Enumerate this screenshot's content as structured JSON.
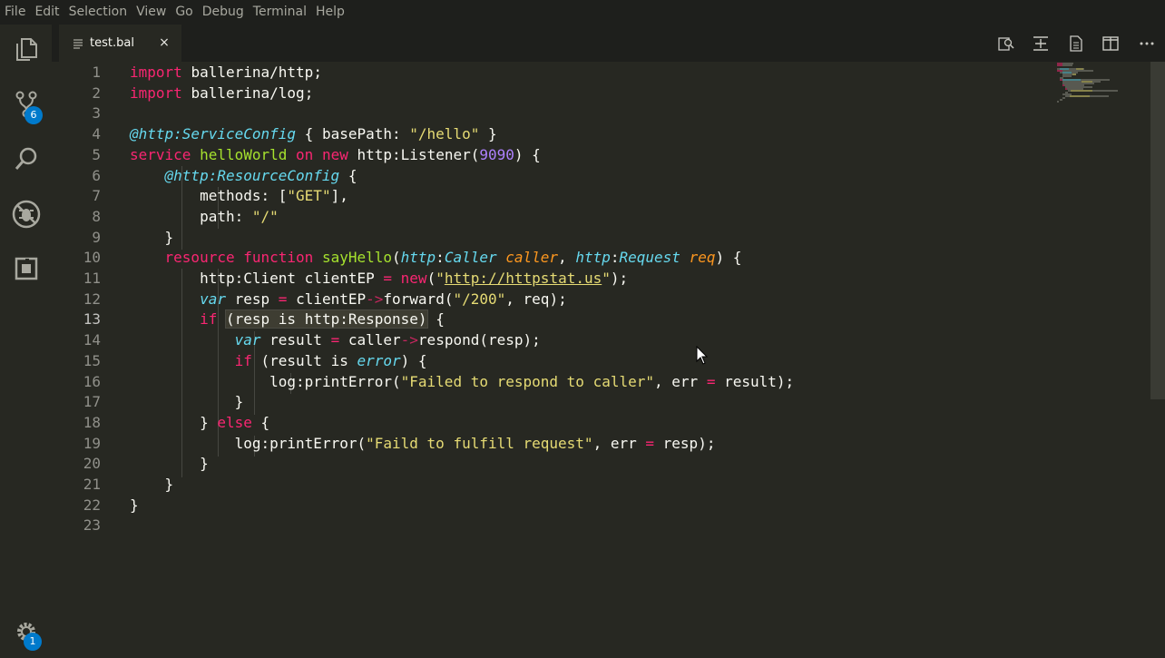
{
  "menu": [
    "File",
    "Edit",
    "Selection",
    "View",
    "Go",
    "Debug",
    "Terminal",
    "Help"
  ],
  "activity": {
    "scm_badge": "6",
    "settings_badge": "1"
  },
  "tab": {
    "label": "test.bal",
    "close": "×"
  },
  "editor": {
    "active_line": 13,
    "lines": [
      {
        "n": "1",
        "text": "import ballerina/http;"
      },
      {
        "n": "2",
        "text": "import ballerina/log;"
      },
      {
        "n": "3",
        "text": ""
      },
      {
        "n": "4",
        "text": "@http:ServiceConfig { basePath: \"/hello\" }"
      },
      {
        "n": "5",
        "text": "service helloWorld on new http:Listener(9090) {"
      },
      {
        "n": "6",
        "text": "    @http:ResourceConfig {"
      },
      {
        "n": "7",
        "text": "        methods: [\"GET\"],"
      },
      {
        "n": "8",
        "text": "        path: \"/\""
      },
      {
        "n": "9",
        "text": "    }"
      },
      {
        "n": "10",
        "text": "    resource function sayHello(http:Caller caller, http:Request req) {"
      },
      {
        "n": "11",
        "text": "        http:Client clientEP = new(\"http://httpstat.us\");"
      },
      {
        "n": "12",
        "text": "        var resp = clientEP->forward(\"/200\", req);"
      },
      {
        "n": "13",
        "text": "        if (resp is http:Response) {"
      },
      {
        "n": "14",
        "text": "            var result = caller->respond(resp);"
      },
      {
        "n": "15",
        "text": "            if (result is error) {"
      },
      {
        "n": "16",
        "text": "                log:printError(\"Failed to respond to caller\", err = result);"
      },
      {
        "n": "17",
        "text": "            }"
      },
      {
        "n": "18",
        "text": "        } else {"
      },
      {
        "n": "19",
        "text": "            log:printError(\"Faild to fulfill request\", err = resp);"
      },
      {
        "n": "20",
        "text": "        }"
      },
      {
        "n": "21",
        "text": "    }"
      },
      {
        "n": "22",
        "text": "}"
      },
      {
        "n": "23",
        "text": ""
      }
    ]
  },
  "colors": {
    "background": "#272822",
    "menubar": "#1e1f1c",
    "keyword": "#f92672",
    "function": "#a6e22e",
    "string": "#e6db74",
    "number": "#ae81ff",
    "type": "#66d9ef",
    "parameter": "#fd971f",
    "badge": "#007acc"
  }
}
